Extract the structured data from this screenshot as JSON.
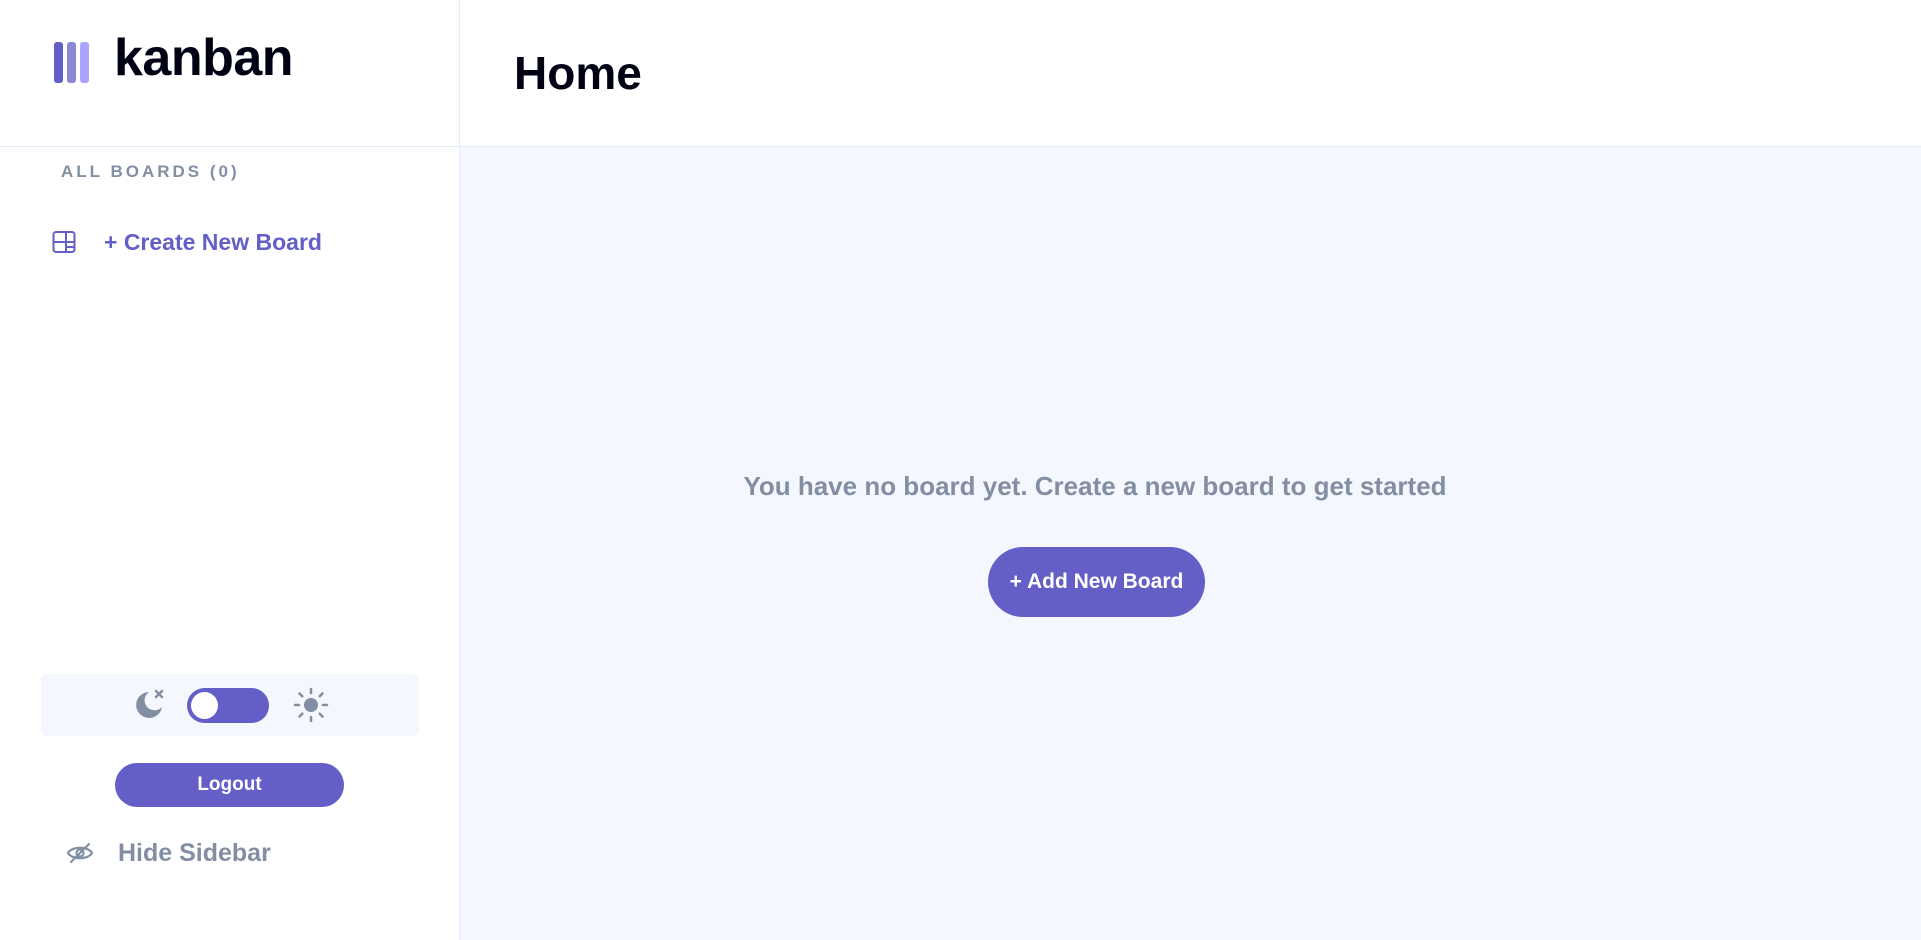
{
  "app": {
    "name": "kanban",
    "colors": {
      "accent": "#635fc7",
      "accent_light": "#a8a4ff",
      "muted_text": "#828fa3",
      "page_bg": "#f4f7fd"
    }
  },
  "sidebar": {
    "all_boards_label": "ALL BOARDS (0)",
    "create_board_label": "+ Create New Board",
    "create_board_icon": "board-icon",
    "theme": {
      "dark_icon": "moon-icon",
      "light_icon": "sun-icon",
      "mode": "dark"
    },
    "logout_label": "Logout",
    "hide_sidebar_label": "Hide Sidebar",
    "hide_sidebar_icon": "eye-slash-icon"
  },
  "header": {
    "title": "Home"
  },
  "main": {
    "empty_message": "You have no board yet. Create a new board to get started",
    "add_board_label": "+ Add New Board"
  }
}
